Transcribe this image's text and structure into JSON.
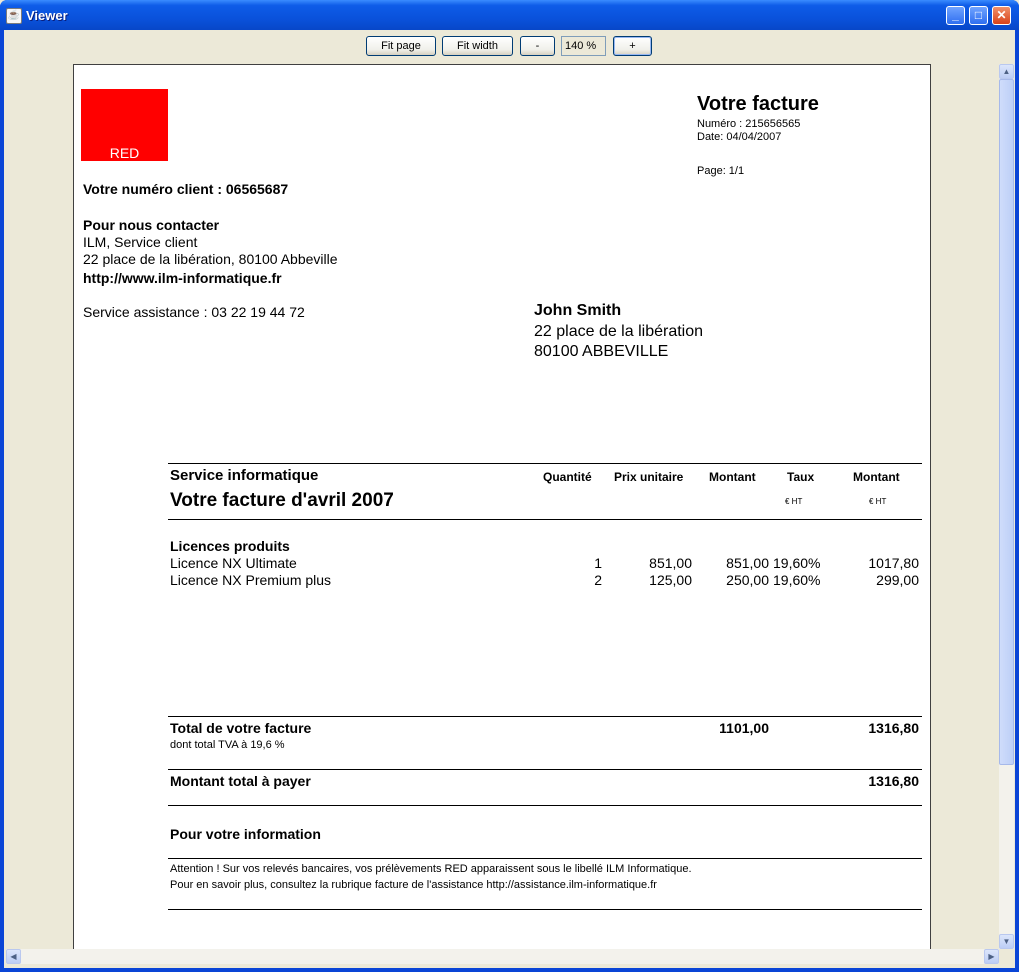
{
  "window": {
    "title": "Viewer",
    "controls": {
      "minimize": "_",
      "maximize": "□",
      "close": "✕"
    }
  },
  "toolbar": {
    "fit_page": "Fit page",
    "fit_width": "Fit width",
    "zoom_out": "-",
    "zoom_value": "140 %",
    "zoom_in": "+"
  },
  "invoice": {
    "logo_text": "RED",
    "title": "Votre facture",
    "numero": "Numéro : 215656565",
    "date": "Date: 04/04/2007",
    "page": "Page: 1/1",
    "client_number": "Votre numéro client : 06565687",
    "contact": {
      "heading": "Pour nous contacter",
      "line1": "ILM, Service client",
      "line2": "22 place de la libération, 80100 Abbeville",
      "url": "http://www.ilm-informatique.fr",
      "assistance": "Service assistance : 03 22 19 44 72"
    },
    "recipient": {
      "name": "John Smith",
      "street": "22 place de la libération",
      "city": "80100 ABBEVILLE"
    },
    "table": {
      "section": "Service informatique",
      "subtitle": "Votre facture d'avril 2007",
      "headers": [
        "Quantité",
        "Prix unitaire",
        "Montant",
        "Taux",
        "Montant"
      ],
      "subheaders": [
        "€ HT",
        "€ HT"
      ],
      "group": "Licences produits",
      "rows": [
        {
          "label": "Licence NX Ultimate",
          "qty": "1",
          "unit": "851,00",
          "amount": "851,00",
          "rate": "19,60%",
          "total": "1017,80"
        },
        {
          "label": "Licence NX Premium plus",
          "qty": "2",
          "unit": "125,00",
          "amount": "250,00",
          "rate": "19,60%",
          "total": "299,00"
        }
      ]
    },
    "totals": {
      "label": "Total de votre facture",
      "tva_note": "dont total TVA à 19,6 %",
      "ht": "1101,00",
      "ttc": "1316,80",
      "pay_label": "Montant total à payer",
      "pay_value": "1316,80"
    },
    "info": {
      "heading": "Pour votre information",
      "line1": "Attention ! Sur vos relevés bancaires, vos prélèvements RED apparaissent sous le libellé ILM Informatique.",
      "line2": "Pour en savoir plus, consultez la rubrique facture de l'assistance http://assistance.ilm-informatique.fr"
    }
  },
  "colors": {
    "titlebar": "#0a52dc",
    "logo": "#ff0000",
    "chrome": "#ece9d8"
  }
}
